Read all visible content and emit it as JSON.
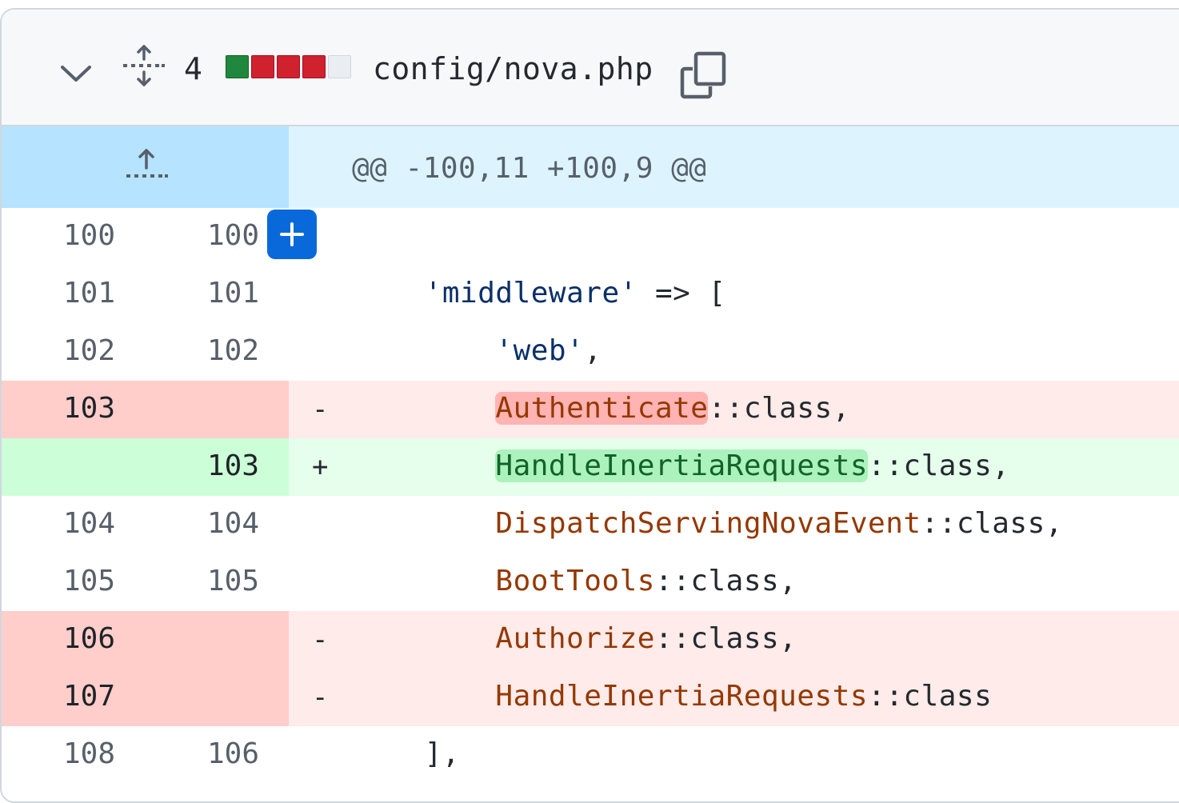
{
  "file": {
    "changes_count": "4",
    "diffstat": [
      "add",
      "del",
      "del",
      "del",
      "neutral"
    ],
    "name": "config/nova.php",
    "colors": {
      "add": "#1f883d",
      "del": "#cf222e",
      "neutral": "#eaeef2",
      "accent": "#0969da"
    }
  },
  "icons": {
    "collapse": "chevron-down-icon",
    "expand_all": "unfold-icon",
    "copy": "copy-icon",
    "expand_up": "fold-up-icon",
    "add_comment": "plus-icon"
  },
  "hunk": {
    "header": "@@ -100,11 +100,9 @@"
  },
  "lines": [
    {
      "type": "context",
      "old": "100",
      "new": "100",
      "marker": "",
      "indent": "",
      "parts": []
    },
    {
      "type": "context",
      "old": "101",
      "new": "101",
      "marker": "",
      "indent": "    ",
      "parts": [
        {
          "text": "'middleware'",
          "cls": "str"
        },
        {
          "text": " => [",
          "cls": ""
        }
      ]
    },
    {
      "type": "context",
      "old": "102",
      "new": "102",
      "marker": "",
      "indent": "        ",
      "parts": [
        {
          "text": "'web'",
          "cls": "str"
        },
        {
          "text": ",",
          "cls": ""
        }
      ]
    },
    {
      "type": "del",
      "old": "103",
      "new": "",
      "marker": "-",
      "indent": "        ",
      "parts": [
        {
          "text": "Authenticate",
          "cls": "hl-del"
        },
        {
          "text": "::class,",
          "cls": ""
        }
      ]
    },
    {
      "type": "add",
      "old": "",
      "new": "103",
      "marker": "+",
      "indent": "        ",
      "parts": [
        {
          "text": "HandleInertiaRequests",
          "cls": "hl-add"
        },
        {
          "text": "::class,",
          "cls": ""
        }
      ]
    },
    {
      "type": "context",
      "old": "104",
      "new": "104",
      "marker": "",
      "indent": "        ",
      "parts": [
        {
          "text": "DispatchServingNovaEvent",
          "cls": "cls"
        },
        {
          "text": "::class,",
          "cls": ""
        }
      ]
    },
    {
      "type": "context",
      "old": "105",
      "new": "105",
      "marker": "",
      "indent": "        ",
      "parts": [
        {
          "text": "BootTools",
          "cls": "cls"
        },
        {
          "text": "::class,",
          "cls": ""
        }
      ]
    },
    {
      "type": "del",
      "old": "106",
      "new": "",
      "marker": "-",
      "indent": "        ",
      "parts": [
        {
          "text": "Authorize",
          "cls": "cls"
        },
        {
          "text": "::class,",
          "cls": ""
        }
      ]
    },
    {
      "type": "del",
      "old": "107",
      "new": "",
      "marker": "-",
      "indent": "        ",
      "parts": [
        {
          "text": "HandleInertiaRequests",
          "cls": "cls"
        },
        {
          "text": "::class",
          "cls": ""
        }
      ]
    },
    {
      "type": "context",
      "old": "108",
      "new": "106",
      "marker": "",
      "indent": "    ",
      "parts": [
        {
          "text": "],",
          "cls": ""
        }
      ]
    }
  ]
}
